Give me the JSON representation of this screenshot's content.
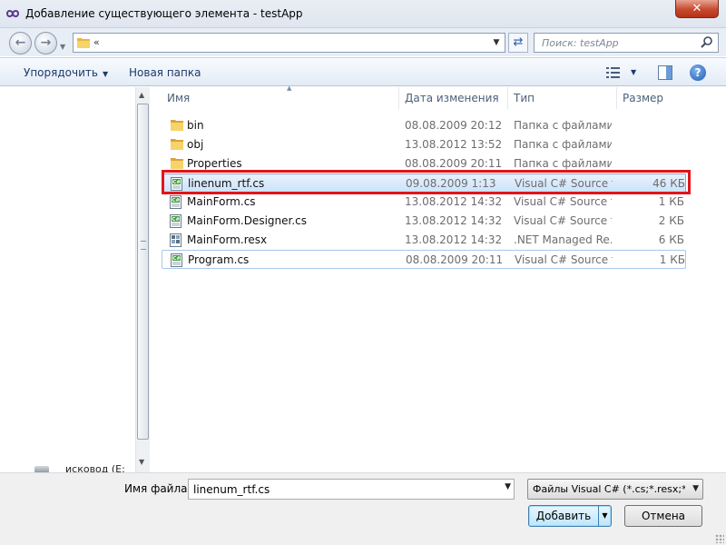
{
  "window": {
    "title": "Добавление существующего элемента - testApp",
    "close_label": "✕"
  },
  "address": {
    "path_prefix": "«",
    "search_placeholder": "Поиск: testApp"
  },
  "toolbar": {
    "organize": "Упорядочить",
    "new_folder": "Новая папка"
  },
  "columns": {
    "name": "Имя",
    "date": "Дата изменения",
    "type": "Тип",
    "size": "Размер"
  },
  "files": [
    {
      "name": "bin",
      "date": "08.08.2009 20:12",
      "type": "Папка с файлами",
      "size": "",
      "icon": "folder-icon"
    },
    {
      "name": "obj",
      "date": "13.08.2012 13:52",
      "type": "Папка с файлами",
      "size": "",
      "icon": "folder-icon"
    },
    {
      "name": "Properties",
      "date": "08.08.2009 20:11",
      "type": "Папка с файлами",
      "size": "",
      "icon": "folder-icon"
    },
    {
      "name": "linenum_rtf.cs",
      "date": "09.08.2009 1:13",
      "type": "Visual C# Source f...",
      "size": "46 КБ",
      "icon": "csharp-file-icon"
    },
    {
      "name": "MainForm.cs",
      "date": "13.08.2012 14:32",
      "type": "Visual C# Source f...",
      "size": "1 КБ",
      "icon": "csharp-file-icon"
    },
    {
      "name": "MainForm.Designer.cs",
      "date": "13.08.2012 14:32",
      "type": "Visual C# Source f...",
      "size": "2 КБ",
      "icon": "csharp-file-icon"
    },
    {
      "name": "MainForm.resx",
      "date": "13.08.2012 14:32",
      "type": ".NET Managed Re...",
      "size": "6 КБ",
      "icon": "resx-file-icon"
    },
    {
      "name": "Program.cs",
      "date": "08.08.2009 20:11",
      "type": "Visual C# Source f...",
      "size": "1 КБ",
      "icon": "csharp-file-icon"
    }
  ],
  "navpane": {
    "disk_label": "исковод (E:"
  },
  "bottom": {
    "filename_label": "Имя файла:",
    "filename_value": "linenum_rtf.cs",
    "filter_value": "Файлы Visual C# (*.cs;*.resx;*.se",
    "add_button": "Добавить",
    "cancel_button": "Отмена"
  },
  "colors": {
    "highlight": "#e0151b",
    "selection": "#cde3fa"
  }
}
